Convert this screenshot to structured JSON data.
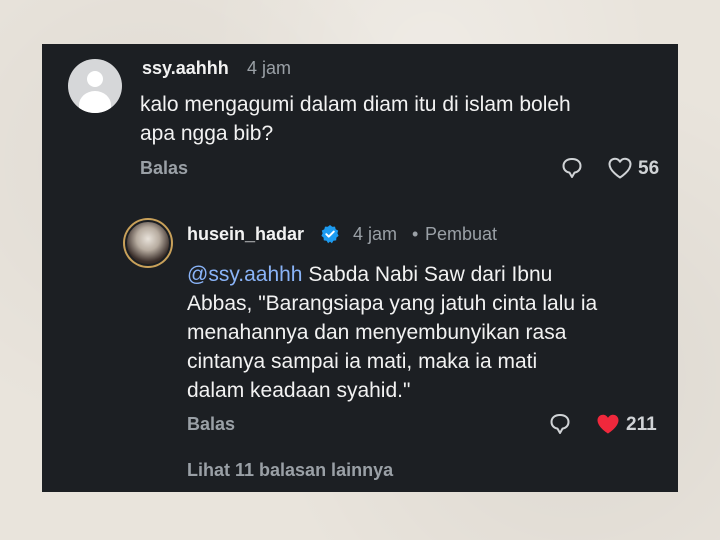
{
  "comment": {
    "username": "ssy.aahhh",
    "time": "4 jam",
    "text_line1": "kalo mengagumi dalam diam itu di islam boleh",
    "text_line2": "apa ngga bib?",
    "reply_label": "Balas",
    "like_count": "56"
  },
  "reply": {
    "username": "husein_hadar",
    "time": "4 jam",
    "separator": "•",
    "author_badge": "Pembuat",
    "mention": "@ssy.aahhh",
    "line1_rest": " Sabda Nabi Saw dari Ibnu",
    "line2": "Abbas, \"Barangsiapa yang jatuh cinta lalu ia",
    "line3": "menahannya dan menyembunyikan rasa",
    "line4": "cintanya sampai ia mati, maka ia mati",
    "line5": "dalam keadaan syahid.\"",
    "reply_label": "Balas",
    "like_count": "211",
    "liked_color": "#f0283c"
  },
  "more_replies": "Lihat 11 balasan lainnya",
  "colors": {
    "card_bg": "#1c1f23",
    "verified": "#1d9bf0",
    "mention": "#8ab4f8"
  },
  "icons": [
    "default-avatar-icon",
    "reply-bubble-icon",
    "heart-outline-icon",
    "verified-badge-icon",
    "heart-filled-icon"
  ]
}
